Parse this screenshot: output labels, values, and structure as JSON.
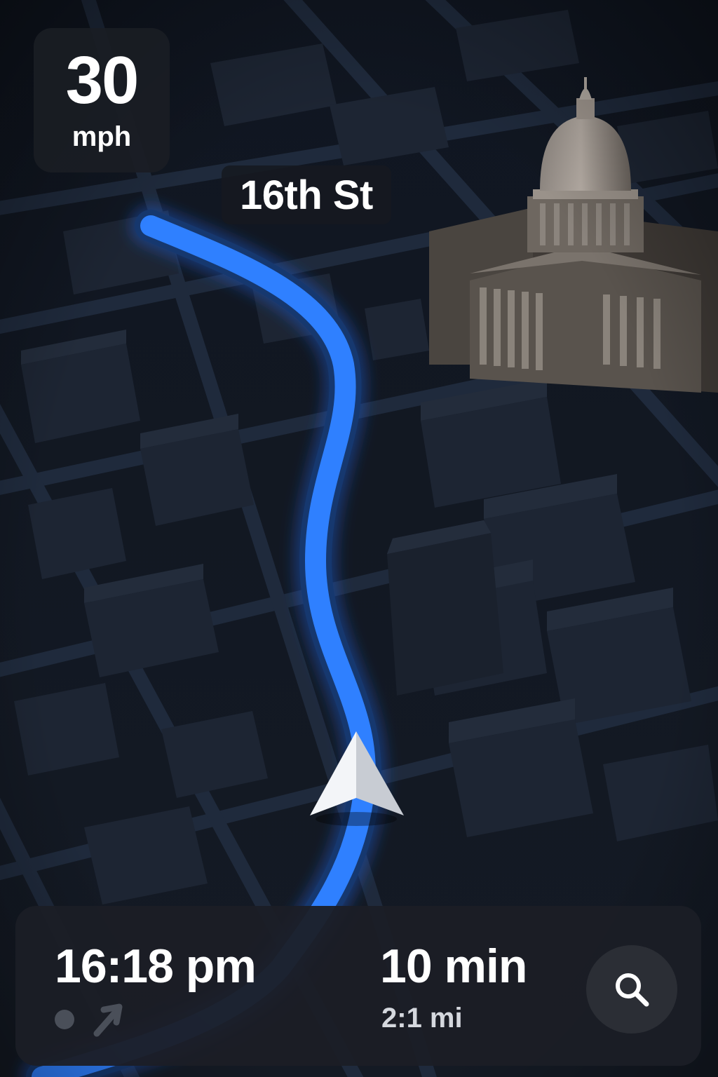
{
  "speed": {
    "value": "30",
    "unit": "mph"
  },
  "street": {
    "name": "16th St"
  },
  "trip": {
    "arrival_time": "16:18 pm",
    "duration": "10 min",
    "distance": "2:1 mi"
  },
  "icons": {
    "navigation": "navigation-arrow-icon",
    "landmark": "capitol-building-icon",
    "status_dot": "dot-icon",
    "direction": "direction-arrow-icon",
    "search": "search-icon"
  },
  "colors": {
    "route": "#2f80ff",
    "map_background": "#111827",
    "panel": "#1b1e26",
    "text": "#ffffff"
  }
}
